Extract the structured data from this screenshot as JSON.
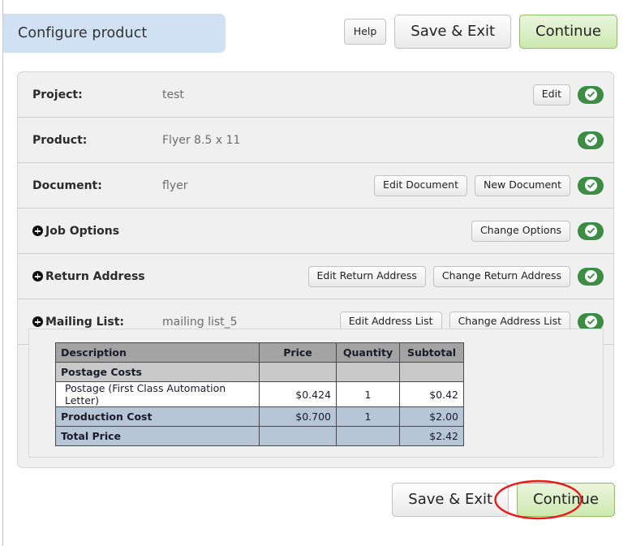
{
  "header": {
    "title": "Configure product",
    "help_label": "Help",
    "save_exit_label": "Save & Exit",
    "continue_label": "Continue"
  },
  "rows": [
    {
      "label": "Project:",
      "value": "test",
      "expander": false,
      "buttons": [
        "Edit"
      ],
      "status": "complete-check"
    },
    {
      "label": "Product:",
      "value": "Flyer 8.5 x 11",
      "expander": false,
      "buttons": [],
      "status": "complete-check"
    },
    {
      "label": "Document:",
      "value": "flyer",
      "expander": false,
      "buttons": [
        "Edit Document",
        "New Document"
      ],
      "status": "complete-check"
    },
    {
      "label": "Job Options",
      "value": "",
      "expander": true,
      "buttons": [
        "Change Options"
      ],
      "status": "complete-check"
    },
    {
      "label": "Return Address",
      "value": "",
      "expander": true,
      "buttons": [
        "Edit Return Address",
        "Change Return Address"
      ],
      "status": "complete-check"
    },
    {
      "label": "Mailing List:",
      "value": "mailing list_5",
      "expander": true,
      "buttons": [
        "Edit Address List",
        "Change Address List"
      ],
      "status": "complete-check"
    }
  ],
  "price_table": {
    "columns": [
      "Description",
      "Price",
      "Quantity",
      "Subtotal"
    ],
    "rows": [
      {
        "type": "group",
        "description": "Postage Costs",
        "price": "",
        "quantity": "",
        "subtotal": ""
      },
      {
        "type": "item",
        "description": "Postage (First Class Automation Letter)",
        "price": "$0.424",
        "quantity": "1",
        "subtotal": "$0.42"
      },
      {
        "type": "summary",
        "description": "Production Cost",
        "price": "$0.700",
        "quantity": "1",
        "subtotal": "$2.00"
      },
      {
        "type": "total",
        "description": "Total Price",
        "price": "",
        "quantity": "",
        "subtotal": "$2.42"
      }
    ]
  },
  "footer": {
    "save_exit_label": "Save & Exit",
    "continue_label": "Continue"
  },
  "annotation": {
    "shape": "red-ellipse-highlight",
    "target": "footer-continue-button",
    "color": "#e81b1b"
  },
  "colors": {
    "title_tab": "#cfe1f3",
    "panel_bg": "#f0f0f0",
    "status_green": "#3c8c44",
    "continue_green_border": "#8cbf5c",
    "table_header": "#a3a3a3",
    "table_group": "#c9c9c9",
    "table_blue": "#b6c6d6",
    "annotation_red": "#e81b1b"
  }
}
